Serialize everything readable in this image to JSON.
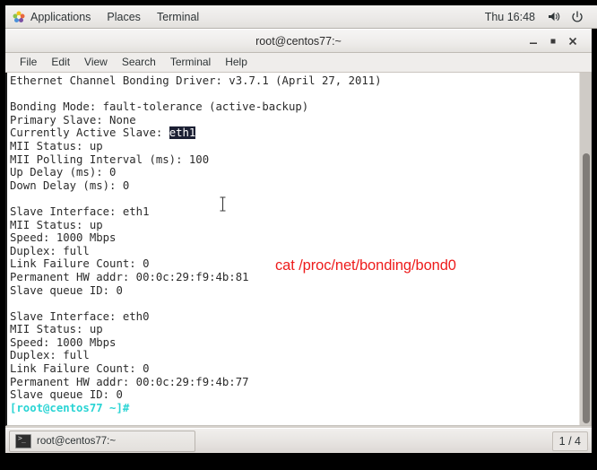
{
  "desktop": {
    "top_panel": {
      "menus": [
        {
          "name": "applications",
          "label": "Applications",
          "icon": "gnome-applications-icon"
        },
        {
          "name": "places",
          "label": "Places"
        },
        {
          "name": "terminal-menu",
          "label": "Terminal"
        }
      ],
      "clock": "Thu 16:48",
      "tray": [
        {
          "name": "volume-icon",
          "label": "volume-icon"
        },
        {
          "name": "power-icon",
          "label": "power-icon"
        }
      ]
    },
    "bottom_panel": {
      "task": {
        "label": "root@centos77:~",
        "icon": "terminal-icon"
      },
      "workspace": "1 / 4"
    }
  },
  "window": {
    "title": "root@centos77:~",
    "controls": {
      "minimize": "–",
      "maximize": "■",
      "close": "✕"
    },
    "menubar": [
      {
        "name": "file",
        "label": "File"
      },
      {
        "name": "edit",
        "label": "Edit"
      },
      {
        "name": "view",
        "label": "View"
      },
      {
        "name": "search",
        "label": "Search"
      },
      {
        "name": "terminal",
        "label": "Terminal"
      },
      {
        "name": "help",
        "label": "Help"
      }
    ]
  },
  "terminal": {
    "annotation": "cat /proc/net/bonding/bond0",
    "annotation_color": "#ee1c1c",
    "selection_text": "eth1",
    "prompt": "[root@centos77 ~]#",
    "prompt_color": "#2ad4d4",
    "lines": [
      {
        "text": "Ethernet Channel Bonding Driver: v3.7.1 (April 27, 2011)"
      },
      {
        "text": ""
      },
      {
        "text": "Bonding Mode: fault-tolerance (active-backup)"
      },
      {
        "text": "Primary Slave: None"
      },
      {
        "text": "Currently Active Slave: ",
        "selected": "eth1"
      },
      {
        "text": "MII Status: up"
      },
      {
        "text": "MII Polling Interval (ms): 100"
      },
      {
        "text": "Up Delay (ms): 0"
      },
      {
        "text": "Down Delay (ms): 0"
      },
      {
        "text": ""
      },
      {
        "text": "Slave Interface: eth1"
      },
      {
        "text": "MII Status: up"
      },
      {
        "text": "Speed: 1000 Mbps"
      },
      {
        "text": "Duplex: full"
      },
      {
        "text": "Link Failure Count: 0"
      },
      {
        "text": "Permanent HW addr: 00:0c:29:f9:4b:81"
      },
      {
        "text": "Slave queue ID: 0"
      },
      {
        "text": ""
      },
      {
        "text": "Slave Interface: eth0"
      },
      {
        "text": "MII Status: up"
      },
      {
        "text": "Speed: 1000 Mbps"
      },
      {
        "text": "Duplex: full"
      },
      {
        "text": "Link Failure Count: 0"
      },
      {
        "text": "Permanent HW addr: 00:0c:29:f9:4b:77"
      },
      {
        "text": "Slave queue ID: 0"
      },
      {
        "text": "",
        "prompt": "[root@centos77 ~]#"
      }
    ]
  }
}
